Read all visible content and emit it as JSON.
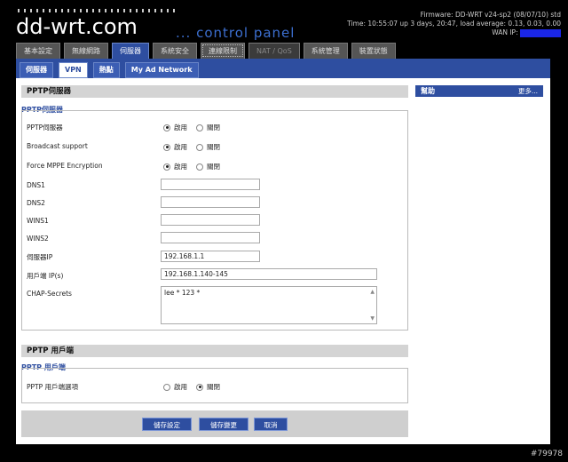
{
  "header": {
    "logo": "dd-wrt.com",
    "tagline": "... control panel",
    "firmware": "Firmware: DD-WRT v24-sp2 (08/07/10) std",
    "time": "Time: 10:55:07 up 3 days, 20:47, load average: 0.13, 0.03, 0.00",
    "wan_ip_label": "WAN IP:"
  },
  "main_tabs": [
    "基本設定",
    "無線網路",
    "伺服器",
    "系統安全",
    "連線限制",
    "NAT / QoS",
    "系統管理",
    "裝置狀態"
  ],
  "sub_tabs": [
    "伺服器",
    "VPN",
    "熱點",
    "My Ad Network"
  ],
  "pptp_server": {
    "section_title": "PPTP伺服器",
    "fieldset_title": "PPTP伺服器",
    "rows": [
      {
        "label": "PPTP伺服器",
        "on": "啟用",
        "off": "關閉",
        "selected": "on"
      },
      {
        "label": "Broadcast support",
        "on": "啟用",
        "off": "關閉",
        "selected": "on"
      },
      {
        "label": "Force MPPE Encryption",
        "on": "啟用",
        "off": "關閉",
        "selected": "on"
      }
    ],
    "dns1_label": "DNS1",
    "dns1": "",
    "dns2_label": "DNS2",
    "dns2": "",
    "wins1_label": "WINS1",
    "wins1": "",
    "wins2_label": "WINS2",
    "wins2": "",
    "server_ip_label": "伺服器IP",
    "server_ip": "192.168.1.1",
    "client_ip_label": "用戶端 IP(s)",
    "client_ip": "192.168.1.140-145",
    "chap_label": "CHAP-Secrets",
    "chap": "lee * 123 *"
  },
  "pptp_client": {
    "section_title": "PPTP 用戶端",
    "fieldset_title": "PPTP 用戶端",
    "option_label": "PPTP 用戶端選項",
    "on": "啟用",
    "off": "關閉",
    "selected": "off"
  },
  "help": {
    "title": "幫助",
    "more": "更多..."
  },
  "buttons": {
    "save": "儲存設定",
    "apply": "儲存變更",
    "cancel": "取消"
  },
  "watermark": "#79978",
  "colors": {
    "accent": "#2e4ea0",
    "wan_ip_mask": "#1a26e6"
  }
}
